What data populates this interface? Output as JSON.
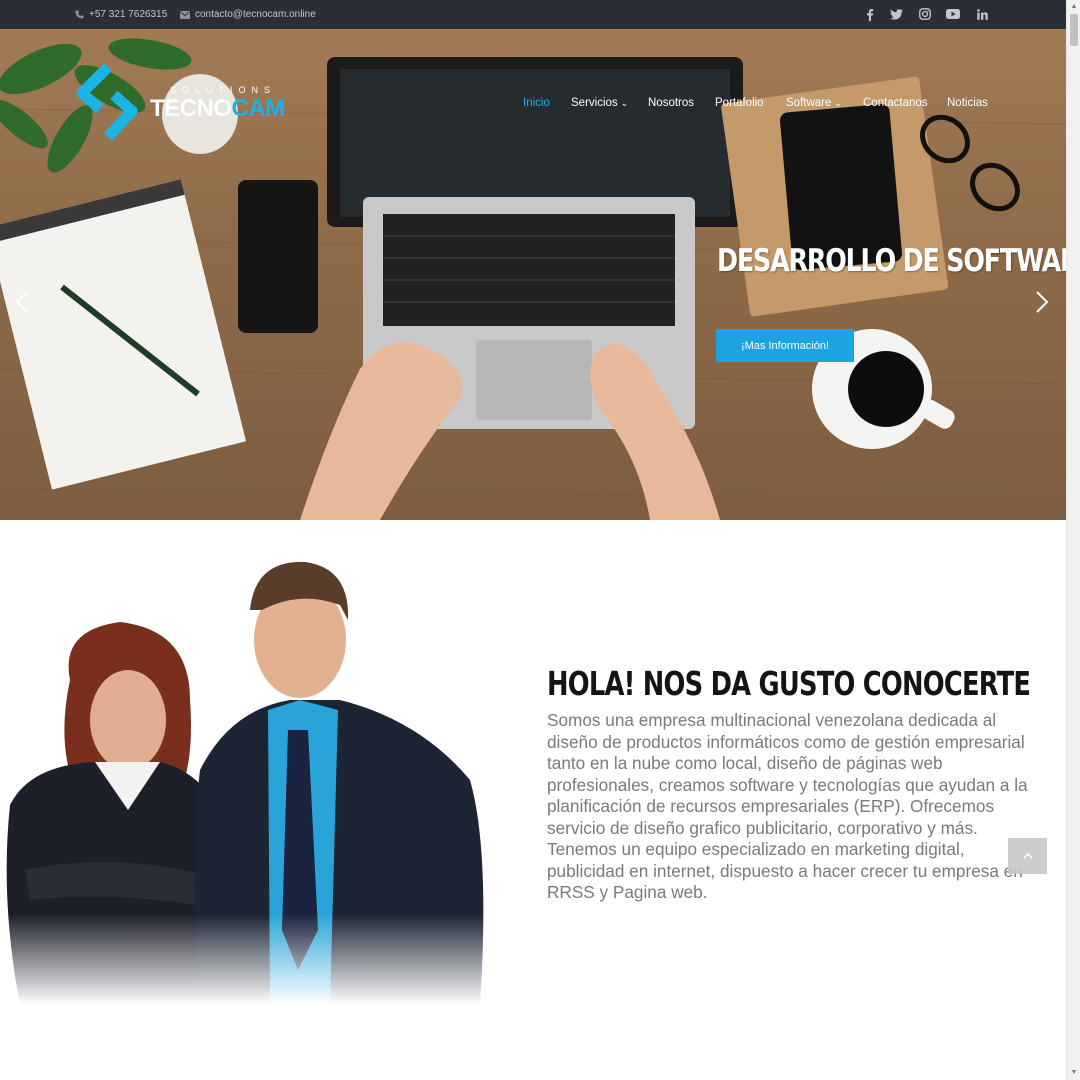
{
  "topbar": {
    "phone": "+57 321 7626315",
    "email": "contacto@tecnocam.online",
    "social_icons": [
      "facebook-icon",
      "twitter-icon",
      "instagram-icon",
      "youtube-icon",
      "linkedin-icon"
    ]
  },
  "logo": {
    "tagline": "SOLUTIONS",
    "brand_part1": "TECNO",
    "brand_part2": "CAM"
  },
  "nav": {
    "items": [
      {
        "label": "Inicio",
        "active": true
      },
      {
        "label": "Servicios",
        "dropdown": true
      },
      {
        "label": "Nosotros"
      },
      {
        "label": "Portafolio"
      },
      {
        "label": "Software",
        "dropdown": true
      },
      {
        "label": "Contactanos"
      },
      {
        "label": "Noticias"
      }
    ]
  },
  "hero": {
    "headline": "DESARROLLO DE SOFTWARE",
    "cta_label": "¡Mas Información!"
  },
  "about": {
    "title": "HOLA! NOS DA GUSTO CONOCERTE",
    "text": "Somos una empresa multinacional venezolana dedicada al diseño de productos informáticos como de gestión empresarial tanto en la nube como local, diseño de páginas web profesionales, creamos software y tecnologías que ayudan a la planificación de recursos empresariales (ERP). Ofrecemos servicio de diseño grafico publicitario, corporativo y más. Tenemos un equipo especializado en marketing digital, publicidad en internet, dispuesto a hacer crecer tu empresa en RRSS y Pagina web."
  },
  "colors": {
    "accent": "#1ba4e0",
    "topbar": "#2a2e35",
    "body_text": "#7a7a7a",
    "heading": "#141414"
  }
}
